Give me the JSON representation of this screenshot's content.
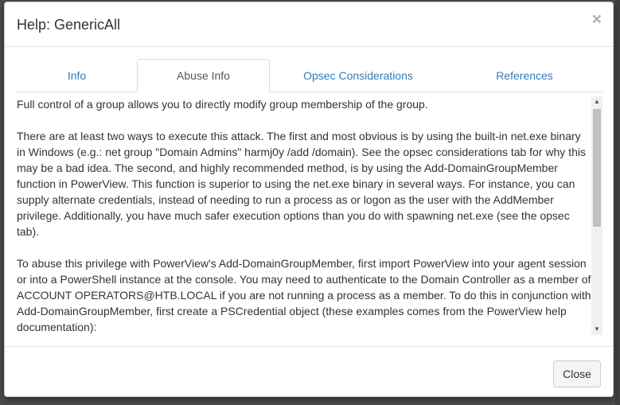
{
  "modal": {
    "title": "Help: GenericAll",
    "close_symbol": "×"
  },
  "tabs": [
    {
      "label": "Info",
      "active": false
    },
    {
      "label": "Abuse Info",
      "active": true
    },
    {
      "label": "Opsec Considerations",
      "active": false
    },
    {
      "label": "References",
      "active": false
    }
  ],
  "content": {
    "paragraphs": [
      "Full control of a group allows you to directly modify group membership of the group.",
      "There are at least two ways to execute this attack. The first and most obvious is by using the built-in net.exe binary in Windows (e.g.: net group \"Domain Admins\" harmj0y /add /domain). See the opsec considerations tab for why this may be a bad idea. The second, and highly recommended method, is by using the Add-DomainGroupMember function in PowerView. This function is superior to using the net.exe binary in several ways. For instance, you can supply alternate credentials, instead of needing to run a process as or logon as the user with the AddMember privilege. Additionally, you have much safer execution options than you do with spawning net.exe (see the opsec tab).",
      "To abuse this privilege with PowerView's Add-DomainGroupMember, first import PowerView into your agent session or into a PowerShell instance at the console. You may need to authenticate to the Domain Controller as a member of ACCOUNT OPERATORS@HTB.LOCAL if you are not running a process as a member. To do this in conjunction with Add-DomainGroupMember, first create a PSCredential object (these examples comes from the PowerView help documentation):"
    ]
  },
  "scrollbar": {
    "up_arrow": "▲",
    "down_arrow": "▼",
    "position_fraction": 0
  },
  "footer": {
    "close_label": "Close"
  },
  "icons": {
    "close": "close-icon",
    "scroll_up": "scroll-up-arrow-icon",
    "scroll_down": "scroll-down-arrow-icon"
  }
}
